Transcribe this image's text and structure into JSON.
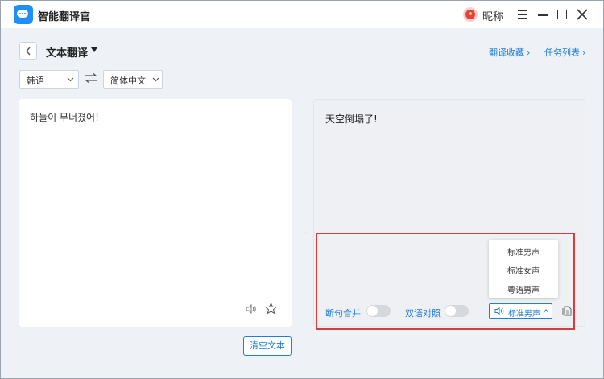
{
  "app": {
    "title": "智能翻译官"
  },
  "user": {
    "nickname": "昵称"
  },
  "toolbar": {
    "page_title": "文本翻译",
    "links": [
      {
        "label": "翻译收藏"
      },
      {
        "label": "任务列表"
      }
    ]
  },
  "languages": {
    "source": "韩语",
    "target": "简体中文"
  },
  "source": {
    "text": "하늘이 무너졌어!"
  },
  "target": {
    "text": "天空倒塌了!"
  },
  "controls": {
    "sentence_merge_label": "断句合并",
    "sentence_merge_on": false,
    "bilingual_label": "双语对照",
    "bilingual_on": false,
    "voice_selected": "标准男声",
    "voice_options": [
      "标准男声",
      "标准女声",
      "粤语男声"
    ]
  },
  "clear_button": "清空文本",
  "colors": {
    "accent": "#1e7fd8",
    "highlight": "#d93a3a"
  }
}
